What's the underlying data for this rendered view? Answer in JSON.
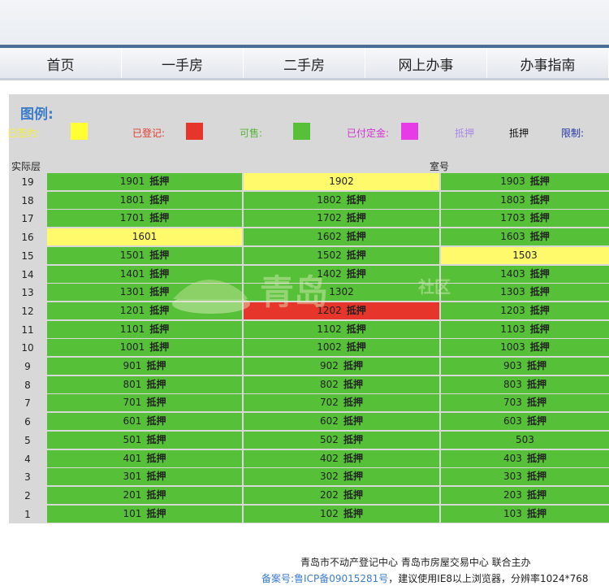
{
  "nav": [
    "首页",
    "一手房",
    "二手房",
    "网上办事",
    "办事指南"
  ],
  "legend": {
    "title": "图例:",
    "items": [
      {
        "label": "已签约:",
        "color": "#f5ef3a",
        "swatch": "#ffff33"
      },
      {
        "label": "已登记:",
        "color": "#e23b2e",
        "swatch": "#e6352a"
      },
      {
        "label": "可售:",
        "color": "#57b53a",
        "swatch": "#56c038"
      },
      {
        "label": "已付定金:",
        "color": "#d333d3",
        "swatch": "#e83be8"
      },
      {
        "label": "抵押",
        "color": "#a98ae6"
      },
      {
        "label": "抵押",
        "color": "#111111"
      },
      {
        "label": "限制:",
        "color": "#2233a8"
      }
    ]
  },
  "headers": {
    "floor": "实际层",
    "room": "室号"
  },
  "mortgage_tag": "抵押",
  "rows": [
    {
      "floor": "19",
      "cells": [
        {
          "room": "1901",
          "tag": true,
          "status": "green"
        },
        {
          "room": "1902",
          "tag": false,
          "status": "yellow"
        },
        {
          "room": "1903",
          "tag": true,
          "status": "green"
        }
      ]
    },
    {
      "floor": "18",
      "cells": [
        {
          "room": "1801",
          "tag": true,
          "status": "green"
        },
        {
          "room": "1802",
          "tag": true,
          "status": "green"
        },
        {
          "room": "1803",
          "tag": true,
          "status": "green"
        }
      ]
    },
    {
      "floor": "17",
      "cells": [
        {
          "room": "1701",
          "tag": true,
          "status": "green"
        },
        {
          "room": "1702",
          "tag": true,
          "status": "green"
        },
        {
          "room": "1703",
          "tag": true,
          "status": "green"
        }
      ]
    },
    {
      "floor": "16",
      "cells": [
        {
          "room": "1601",
          "tag": false,
          "status": "yellow"
        },
        {
          "room": "1602",
          "tag": true,
          "status": "green"
        },
        {
          "room": "1603",
          "tag": true,
          "status": "green"
        }
      ]
    },
    {
      "floor": "15",
      "cells": [
        {
          "room": "1501",
          "tag": true,
          "status": "green"
        },
        {
          "room": "1502",
          "tag": true,
          "status": "green"
        },
        {
          "room": "1503",
          "tag": false,
          "status": "yellow"
        }
      ]
    },
    {
      "floor": "14",
      "cells": [
        {
          "room": "1401",
          "tag": true,
          "status": "green"
        },
        {
          "room": "1402",
          "tag": true,
          "status": "green"
        },
        {
          "room": "1403",
          "tag": true,
          "status": "green"
        }
      ]
    },
    {
      "floor": "13",
      "cells": [
        {
          "room": "1301",
          "tag": true,
          "status": "green"
        },
        {
          "room": "1302",
          "tag": false,
          "status": "green"
        },
        {
          "room": "1303",
          "tag": true,
          "status": "green"
        }
      ]
    },
    {
      "floor": "12",
      "cells": [
        {
          "room": "1201",
          "tag": true,
          "status": "green"
        },
        {
          "room": "1202",
          "tag": true,
          "status": "red"
        },
        {
          "room": "1203",
          "tag": true,
          "status": "green"
        }
      ]
    },
    {
      "floor": "11",
      "cells": [
        {
          "room": "1101",
          "tag": true,
          "status": "green"
        },
        {
          "room": "1102",
          "tag": true,
          "status": "green"
        },
        {
          "room": "1103",
          "tag": true,
          "status": "green"
        }
      ]
    },
    {
      "floor": "10",
      "cells": [
        {
          "room": "1001",
          "tag": true,
          "status": "green"
        },
        {
          "room": "1002",
          "tag": true,
          "status": "green"
        },
        {
          "room": "1003",
          "tag": true,
          "status": "green"
        }
      ]
    },
    {
      "floor": "9",
      "cells": [
        {
          "room": "901",
          "tag": true,
          "status": "green"
        },
        {
          "room": "902",
          "tag": true,
          "status": "green"
        },
        {
          "room": "903",
          "tag": true,
          "status": "green"
        }
      ]
    },
    {
      "floor": "8",
      "cells": [
        {
          "room": "801",
          "tag": true,
          "status": "green"
        },
        {
          "room": "802",
          "tag": true,
          "status": "green"
        },
        {
          "room": "803",
          "tag": true,
          "status": "green"
        }
      ]
    },
    {
      "floor": "7",
      "cells": [
        {
          "room": "701",
          "tag": true,
          "status": "green"
        },
        {
          "room": "702",
          "tag": true,
          "status": "green"
        },
        {
          "room": "703",
          "tag": true,
          "status": "green"
        }
      ]
    },
    {
      "floor": "6",
      "cells": [
        {
          "room": "601",
          "tag": true,
          "status": "green"
        },
        {
          "room": "602",
          "tag": true,
          "status": "green"
        },
        {
          "room": "603",
          "tag": true,
          "status": "green"
        }
      ]
    },
    {
      "floor": "5",
      "cells": [
        {
          "room": "501",
          "tag": true,
          "status": "green"
        },
        {
          "room": "502",
          "tag": true,
          "status": "green"
        },
        {
          "room": "503",
          "tag": false,
          "status": "green"
        }
      ]
    },
    {
      "floor": "4",
      "cells": [
        {
          "room": "401",
          "tag": true,
          "status": "green"
        },
        {
          "room": "402",
          "tag": true,
          "status": "green"
        },
        {
          "room": "403",
          "tag": true,
          "status": "green"
        }
      ]
    },
    {
      "floor": "3",
      "cells": [
        {
          "room": "301",
          "tag": true,
          "status": "green"
        },
        {
          "room": "302",
          "tag": true,
          "status": "green"
        },
        {
          "room": "303",
          "tag": true,
          "status": "green"
        }
      ]
    },
    {
      "floor": "2",
      "cells": [
        {
          "room": "201",
          "tag": true,
          "status": "green"
        },
        {
          "room": "202",
          "tag": true,
          "status": "green"
        },
        {
          "room": "203",
          "tag": true,
          "status": "green"
        }
      ]
    },
    {
      "floor": "1",
      "cells": [
        {
          "room": "101",
          "tag": true,
          "status": "green"
        },
        {
          "room": "102",
          "tag": true,
          "status": "green"
        },
        {
          "room": "103",
          "tag": true,
          "status": "green"
        }
      ]
    }
  ],
  "watermark": {
    "text": "青岛",
    "sub": "社区"
  },
  "footer": {
    "line1": "青岛市不动产登记中心 青岛市房屋交易中心 联合主办",
    "icp": "备案号:鲁ICP备09015281号",
    "line2_rest": "，建议使用IE8以上浏览器，分辨率1024*768"
  }
}
